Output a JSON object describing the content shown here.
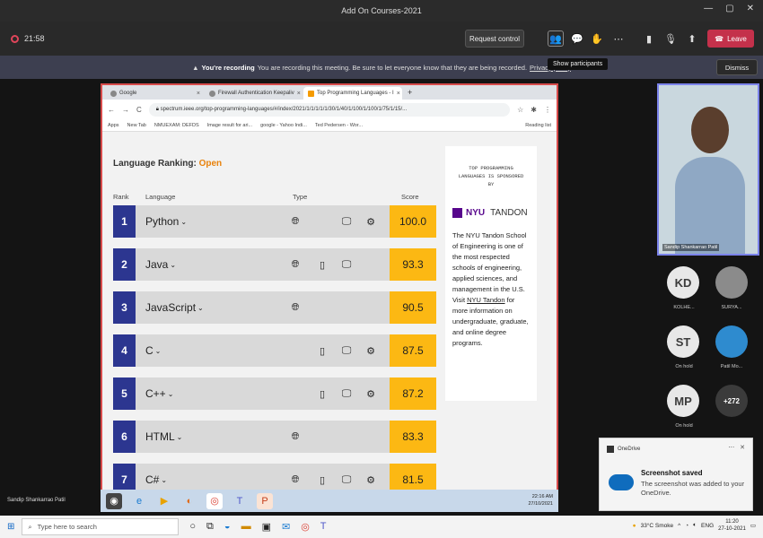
{
  "window": {
    "title": "Add On Courses-2021",
    "controls": [
      "—",
      "▢",
      "✕"
    ]
  },
  "meeting": {
    "timer": "21:58",
    "request_control": "Request control",
    "leave": "Leave",
    "show_participants_tooltip": "Show participants",
    "recording_banner": {
      "bold": "You're recording",
      "text": "You are recording this meeting. Be sure to let everyone know that they are being recorded.",
      "link": "Privacy policy"
    },
    "dismiss": "Dismiss",
    "presenter": "Sandip Shankarrao Patil"
  },
  "browser": {
    "tabs": [
      {
        "title": "Google"
      },
      {
        "title": "Firewall Authentication Keepaliv"
      },
      {
        "title": "Top Programming Languages - I"
      }
    ],
    "new_tab": "+",
    "url": "spectrum.ieee.org/top-programming-languages/#/index/2021/1/1/1/1/1/30/1/40/1/100/1/100/1/75/1/15/...",
    "bookmarks": [
      "Apps",
      "New Tab",
      "NMUEXAM: DEFDS",
      "Image result for ari...",
      "google - Yahoo Indi...",
      "Ted Pedersen - Wor..."
    ],
    "reading_list": "Reading list"
  },
  "ranking": {
    "title_prefix": "Language Ranking:",
    "title_value": "Open",
    "headers": {
      "rank": "Rank",
      "language": "Language",
      "type": "Type",
      "score": "Score"
    },
    "rows": [
      {
        "rank": "1",
        "language": "Python",
        "score": "100.0",
        "web": true,
        "mobile": false,
        "desktop": true,
        "embedded": true
      },
      {
        "rank": "2",
        "language": "Java",
        "score": "93.3",
        "web": true,
        "mobile": true,
        "desktop": true,
        "embedded": false
      },
      {
        "rank": "3",
        "language": "JavaScript",
        "score": "90.5",
        "web": true,
        "mobile": false,
        "desktop": false,
        "embedded": false
      },
      {
        "rank": "4",
        "language": "C",
        "score": "87.5",
        "web": false,
        "mobile": true,
        "desktop": true,
        "embedded": true
      },
      {
        "rank": "5",
        "language": "C++",
        "score": "87.2",
        "web": false,
        "mobile": true,
        "desktop": true,
        "embedded": true
      },
      {
        "rank": "6",
        "language": "HTML",
        "score": "83.3",
        "web": true,
        "mobile": false,
        "desktop": false,
        "embedded": false
      },
      {
        "rank": "7",
        "language": "C#",
        "score": "81.5",
        "web": true,
        "mobile": true,
        "desktop": true,
        "embedded": true
      }
    ]
  },
  "sponsor": {
    "heading_lines": [
      "TOP PROGRAMMING",
      "LANGUAGES IS SPONSORED",
      "BY"
    ],
    "logo_left": "NYU",
    "logo_right": "TANDON",
    "body_before_link": "The NYU Tandon School of Engineering is one of the most respected schools of engineering, applied sciences, and management in the U.S. Visit",
    "link": "NYU Tandon",
    "body_after_link": "for more information on undergraduate, graduate, and online degree programs."
  },
  "inner_clock": {
    "time": "22:16 AM",
    "date": "27/10/2021"
  },
  "participants": {
    "video_name": "Sandip Shankarrao Patil",
    "items": [
      {
        "initials": "KD",
        "label": "KOLHE..."
      },
      {
        "initials": "",
        "label": "SURYA..."
      },
      {
        "initials": "ST",
        "label": "On hold"
      },
      {
        "initials": "",
        "label": "Patil Mo..."
      },
      {
        "initials": "MP",
        "label": "On hold"
      },
      {
        "initials": "+272",
        "label": ""
      }
    ]
  },
  "toast": {
    "app": "OneDrive",
    "title": "Screenshot saved",
    "text": "The screenshot was added to your OneDrive."
  },
  "taskbar": {
    "search_placeholder": "Type here to search",
    "weather": "33°C Smoke",
    "lang": "ENG",
    "time": "11:20",
    "date": "27-10-2021"
  },
  "colors": {
    "accent": "#2c3690",
    "score": "#fcb813",
    "leave": "#c4314b",
    "recording_border": "#d84b4b"
  }
}
